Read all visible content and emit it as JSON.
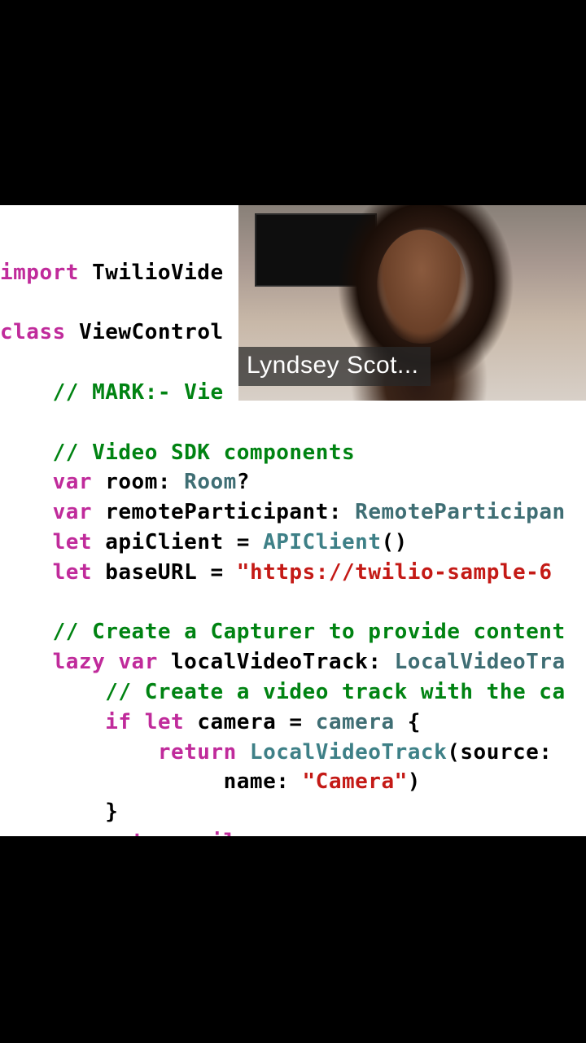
{
  "video_overlay": {
    "participant_name": "Lyndsey Scot..."
  },
  "code": {
    "l1": {
      "kw": "import",
      "sp": " ",
      "id": "TwilioVide"
    },
    "l2": "",
    "l3": {
      "kw": "class",
      "sp": " ",
      "id": "ViewControl"
    },
    "l4": "",
    "l5": {
      "indent": "    ",
      "comment": "// MARK:- Vie"
    },
    "l6": "",
    "l7": {
      "indent": "    ",
      "comment": "// Video SDK components"
    },
    "l8": {
      "indent": "    ",
      "kw": "var",
      "sp": " ",
      "id": "room: ",
      "type": "Room",
      "q": "?"
    },
    "l9": {
      "indent": "    ",
      "kw": "var",
      "sp": " ",
      "id": "remoteParticipant: ",
      "type": "RemoteParticipan"
    },
    "l10": {
      "indent": "    ",
      "kw": "let",
      "sp": " ",
      "id": "apiClient = ",
      "type": "APIClient",
      "paren": "()"
    },
    "l11": {
      "indent": "    ",
      "kw": "let",
      "sp": " ",
      "id": "baseURL = ",
      "str": "\"https://twilio-sample-6"
    },
    "l12": "",
    "l13": {
      "indent": "    ",
      "comment": "// Create a Capturer to provide content"
    },
    "l14": {
      "indent": "    ",
      "kw1": "lazy",
      "sp1": " ",
      "kw2": "var",
      "sp2": " ",
      "id": "localVideoTrack: ",
      "type": "LocalVideoTra"
    },
    "l15": {
      "indent": "        ",
      "comment": "// Create a video track with the ca"
    },
    "l16": {
      "indent": "        ",
      "kw1": "if",
      "sp1": " ",
      "kw2": "let",
      "sp2": " ",
      "id1": "camera = ",
      "id2": "camera",
      "brace": " {"
    },
    "l17": {
      "indent": "            ",
      "kw": "return",
      "sp": " ",
      "type": "LocalVideoTrack",
      "paren": "(source:"
    },
    "l18": {
      "indent": "                 ",
      "id": "name: ",
      "str": "\"Camera\"",
      "paren": ")"
    },
    "l19": {
      "indent": "        ",
      "brace": "}"
    },
    "l20": {
      "indent": "        ",
      "kw": "return",
      "sp": " ",
      "nil": "nil"
    }
  }
}
